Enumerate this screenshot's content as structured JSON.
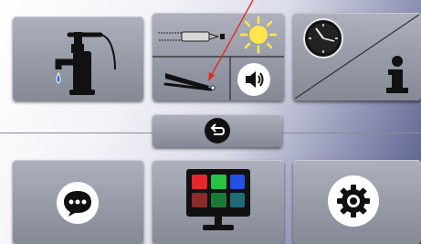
{
  "icons": {
    "water_pump": "water-pump-icon",
    "pencil_light": "pencil-light-icon",
    "sun": "sun-icon",
    "pen_on_surface": "pen-on-surface-icon",
    "speaker": "speaker-icon",
    "clock": "analog-clock-icon",
    "info": "info-icon",
    "back": "back-arrow-icon",
    "chat": "chat-bubble-icon",
    "display_colors": "color-display-icon",
    "settings": "gear-icon"
  },
  "colors": {
    "tile": "#9699a6",
    "annotation_arrow": "#e2261c",
    "water_drop": "#1f6fd6",
    "sun": "#ffe64a",
    "palette": [
      "#e8252b",
      "#27c447",
      "#2450e6",
      "#8b2b2b",
      "#1d7b3a",
      "#1f6b78"
    ]
  }
}
